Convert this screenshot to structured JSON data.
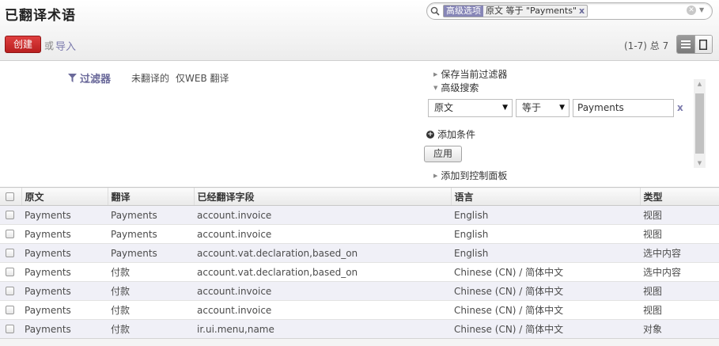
{
  "header": {
    "title": "已翻译术语",
    "create_label": "创建",
    "or_label": "或",
    "import_label": "导入",
    "pager": "(1-7) 总 7"
  },
  "search": {
    "facet_category": "高级选项",
    "facet_value": "原文 等于 \"Payments\"",
    "facet_remove": "x"
  },
  "drawer": {
    "filters_title": "过滤器",
    "filters": [
      "未翻译的",
      "仅WEB 翻译"
    ],
    "save_filter": "保存当前过滤器",
    "advanced_search": "高级搜索",
    "condition": {
      "field": "原文",
      "operator": "等于",
      "value": "Payments",
      "remove": "x"
    },
    "add_condition": "添加条件",
    "apply": "应用",
    "add_to_dashboard": "添加到控制面板"
  },
  "table": {
    "columns": [
      "原文",
      "翻译",
      "已经翻译字段",
      "语言",
      "类型"
    ],
    "rows": [
      [
        "Payments",
        "Payments",
        "account.invoice",
        "English",
        "视图"
      ],
      [
        "Payments",
        "Payments",
        "account.invoice",
        "English",
        "视图"
      ],
      [
        "Payments",
        "Payments",
        "account.vat.declaration,based_on",
        "English",
        "选中内容"
      ],
      [
        "Payments",
        "付款",
        "account.vat.declaration,based_on",
        "Chinese (CN) / 简体中文",
        "选中内容"
      ],
      [
        "Payments",
        "付款",
        "account.invoice",
        "Chinese (CN) / 简体中文",
        "视图"
      ],
      [
        "Payments",
        "付款",
        "account.invoice",
        "Chinese (CN) / 简体中文",
        "视图"
      ],
      [
        "Payments",
        "付款",
        "ir.ui.menu,name",
        "Chinese (CN) / 简体中文",
        "对象"
      ]
    ]
  },
  "colors": {
    "accent": "#7c7bad",
    "create_button": "#c9302c",
    "facet_category_bg": "#8786b7",
    "row_alt": "#f0f0f7"
  },
  "icons": {
    "search": "magnifier-icon",
    "filter": "funnel-icon",
    "list_view": "list-view-icon",
    "form_view": "form-view-icon",
    "add": "plus-circle-icon"
  }
}
